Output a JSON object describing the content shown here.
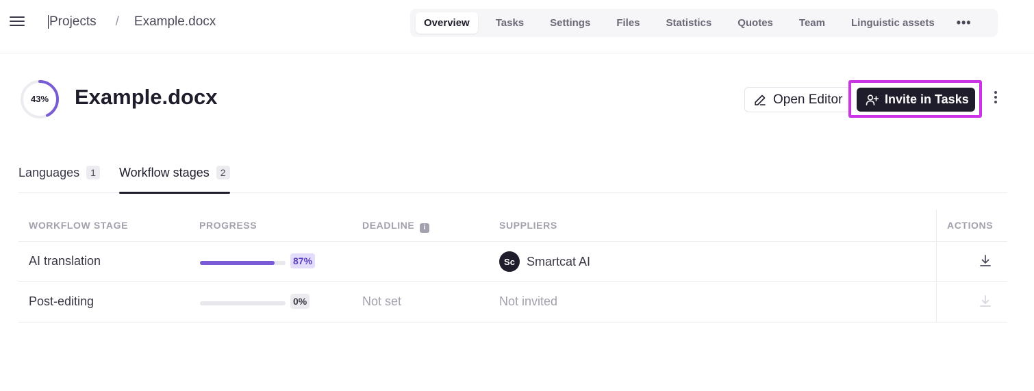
{
  "breadcrumb": {
    "projects_label": "Projects",
    "separator": "/",
    "current": "Example.docx"
  },
  "nav": {
    "tabs": [
      {
        "label": "Overview",
        "active": true
      },
      {
        "label": "Tasks"
      },
      {
        "label": "Settings"
      },
      {
        "label": "Files"
      },
      {
        "label": "Statistics"
      },
      {
        "label": "Quotes"
      },
      {
        "label": "Team"
      },
      {
        "label": "Linguistic assets"
      }
    ],
    "more_label": "•••"
  },
  "header": {
    "progress_value": 43,
    "progress_label": "43%",
    "title": "Example.docx",
    "open_editor_label": "Open Editor",
    "invite_label": "Invite in Tasks"
  },
  "subtabs": [
    {
      "label": "Languages",
      "count": "1"
    },
    {
      "label": "Workflow stages",
      "count": "2",
      "active": true
    }
  ],
  "table": {
    "columns": {
      "stage": "WORKFLOW STAGE",
      "progress": "PROGRESS",
      "deadline": "DEADLINE",
      "suppliers": "SUPPLIERS",
      "actions": "ACTIONS"
    },
    "rows": [
      {
        "stage": "AI translation",
        "progress": 87,
        "progress_label": "87%",
        "deadline": "",
        "supplier": "Smartcat AI",
        "supplier_avatar": "Sc"
      },
      {
        "stage": "Post-editing",
        "progress": 0,
        "progress_label": "0%",
        "deadline": "Not set",
        "supplier": "Not invited"
      }
    ]
  },
  "colors": {
    "accent": "#7a5bd6",
    "primary_button": "#1f1d2b",
    "highlight": "#cc33e6"
  }
}
